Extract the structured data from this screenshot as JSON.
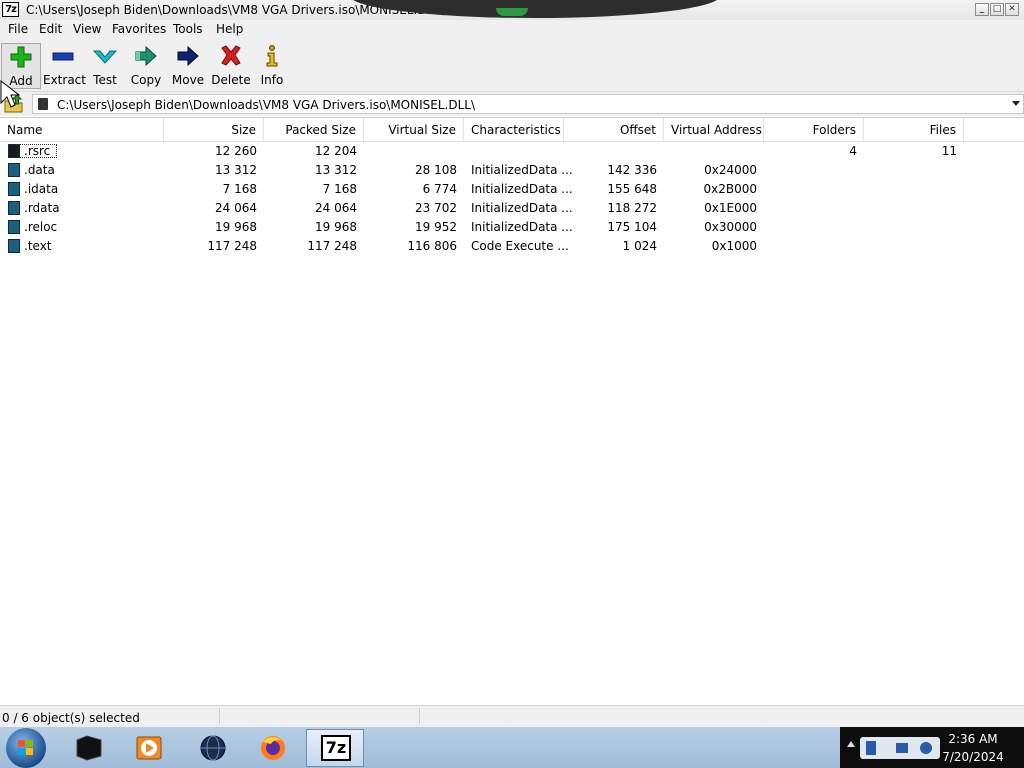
{
  "window": {
    "title": "C:\\Users\\Joseph Biden\\Downloads\\VM8 VGA Drivers.iso\\MONISEL.DLL\\",
    "app_icon_label": "7z",
    "controls": {
      "minimize": "_",
      "maximize": "□",
      "close": "✕"
    }
  },
  "menu": {
    "items": [
      "File",
      "Edit",
      "View",
      "Favorites",
      "Tools",
      "Help"
    ]
  },
  "toolbar": {
    "buttons": [
      {
        "label": "Add",
        "icon": "plus-icon",
        "color": "#1fb21f"
      },
      {
        "label": "Extract",
        "icon": "minus-icon",
        "color": "#1a3fb0"
      },
      {
        "label": "Test",
        "icon": "checkmark-icon",
        "color": "#22b8c8"
      },
      {
        "label": "Copy",
        "icon": "copy-arrows-icon",
        "color": "#1f8f6e"
      },
      {
        "label": "Move",
        "icon": "arrow-right-icon",
        "color": "#14216b"
      },
      {
        "label": "Delete",
        "icon": "x-icon",
        "color": "#d61f1f"
      },
      {
        "label": "Info",
        "icon": "info-icon",
        "color": "#c9a100"
      }
    ]
  },
  "pathbar": {
    "path": "C:\\Users\\Joseph Biden\\Downloads\\VM8 VGA Drivers.iso\\MONISEL.DLL\\"
  },
  "list": {
    "columns": [
      "Name",
      "Size",
      "Packed Size",
      "Virtual Size",
      "Characteristics",
      "Offset",
      "Virtual Address",
      "Folders",
      "Files"
    ],
    "rows": [
      {
        "name": ".rsrc",
        "size": "12 260",
        "packed": "12 204",
        "virtual": "",
        "chars": "",
        "offset": "",
        "vaddr": "",
        "folders": "4",
        "files": "11",
        "icon": "folder-dark",
        "focused": true
      },
      {
        "name": ".data",
        "size": "13 312",
        "packed": "13 312",
        "virtual": "28 108",
        "chars": "InitializedData ...",
        "offset": "142 336",
        "vaddr": "0x24000",
        "folders": "",
        "files": "",
        "icon": "file"
      },
      {
        "name": ".idata",
        "size": "7 168",
        "packed": "7 168",
        "virtual": "6 774",
        "chars": "InitializedData ...",
        "offset": "155 648",
        "vaddr": "0x2B000",
        "folders": "",
        "files": "",
        "icon": "file"
      },
      {
        "name": ".rdata",
        "size": "24 064",
        "packed": "24 064",
        "virtual": "23 702",
        "chars": "InitializedData ...",
        "offset": "118 272",
        "vaddr": "0x1E000",
        "folders": "",
        "files": "",
        "icon": "file"
      },
      {
        "name": ".reloc",
        "size": "19 968",
        "packed": "19 968",
        "virtual": "19 952",
        "chars": "InitializedData ...",
        "offset": "175 104",
        "vaddr": "0x30000",
        "folders": "",
        "files": "",
        "icon": "file"
      },
      {
        "name": ".text",
        "size": "117 248",
        "packed": "117 248",
        "virtual": "116 806",
        "chars": "Code Execute ...",
        "offset": "1 024",
        "vaddr": "0x1000",
        "folders": "",
        "files": "",
        "icon": "file"
      }
    ]
  },
  "status": {
    "text": "0 / 6 object(s) selected"
  },
  "taskbar": {
    "items": [
      {
        "icon": "terminal-icon",
        "active": false
      },
      {
        "icon": "media-player-icon",
        "active": false
      },
      {
        "icon": "globe-icon",
        "active": false
      },
      {
        "icon": "firefox-icon",
        "active": false
      },
      {
        "icon": "7zip-icon",
        "active": true,
        "label": "7z"
      }
    ],
    "clock": {
      "time": "2:36 AM",
      "date": "7/20/2024"
    }
  }
}
